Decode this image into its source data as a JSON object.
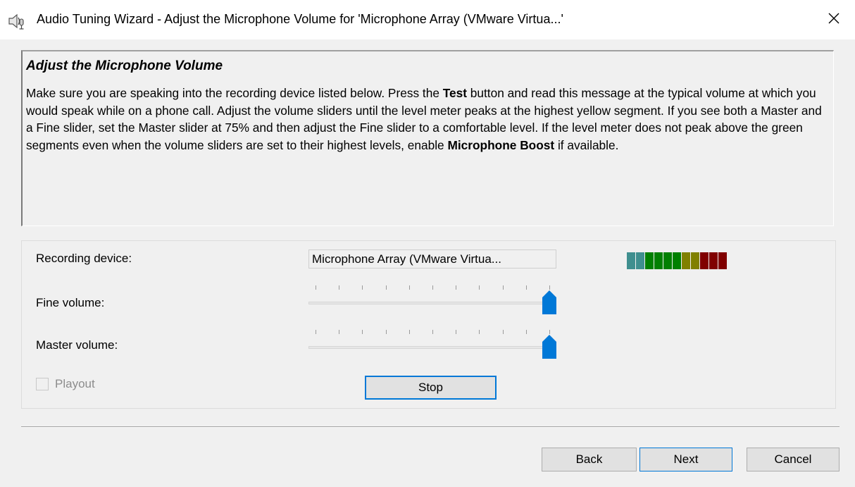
{
  "window": {
    "title": "Audio Tuning Wizard - Adjust the Microphone Volume for 'Microphone Array (VMware Virtua...'",
    "close_icon": "close-icon",
    "app_icon": "speaker-microphone-icon"
  },
  "info": {
    "heading": "Adjust the Microphone Volume",
    "body_part1": "Make sure you are speaking into the recording device listed below. Press the ",
    "body_bold1": "Test",
    "body_part2": " button and read this message at the typical volume at which you would speak while on a phone call. Adjust the volume sliders until the level meter peaks at the highest yellow segment. If you see both a Master and a Fine slider, set the Master slider at 75% and then adjust the Fine slider to a comfortable level. If the level meter does not peak above the green segments even when the volume sliders are set to their highest levels, enable ",
    "body_bold2": "Microphone Boost",
    "body_part3": " if available."
  },
  "recording": {
    "label": "Recording device:",
    "device_value": "Microphone Array (VMware Virtua..."
  },
  "level_meter": {
    "colors": [
      "#3f8f8f",
      "#3f8f8f",
      "#008000",
      "#008000",
      "#008000",
      "#008000",
      "#808000",
      "#808000",
      "#800000",
      "#800000",
      "#800000"
    ]
  },
  "fine_volume": {
    "label": "Fine volume:",
    "value_percent": 100
  },
  "master_volume": {
    "label": "Master volume:",
    "value_percent": 100
  },
  "playout": {
    "label": "Playout",
    "checked": false,
    "enabled": false
  },
  "buttons": {
    "stop": "Stop",
    "back": "Back",
    "next": "Next",
    "cancel": "Cancel"
  },
  "colors": {
    "accent": "#0078d7"
  }
}
